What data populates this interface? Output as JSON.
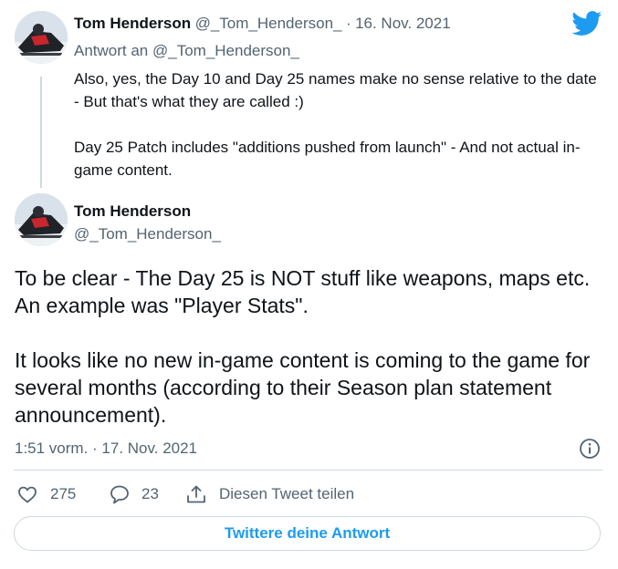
{
  "reply_tweet": {
    "author_name": "Tom Henderson",
    "author_handle": "@_Tom_Henderson_",
    "separator": "·",
    "date": "16. Nov. 2021",
    "replying_to": "Antwort an @_Tom_Henderson_",
    "paragraphs": [
      "Also, yes, the Day 10 and Day 25 names make no sense relative to the date - But that's what they are called :)",
      "Day 25 Patch includes \"additions pushed from launch\" - And not actual in-game content."
    ]
  },
  "main_tweet": {
    "author_name": "Tom Henderson",
    "author_handle": "@_Tom_Henderson_",
    "paragraphs": [
      "To be clear - The Day 25 is NOT stuff like weapons, maps etc. An example was \"Player Stats\".",
      "It looks like no new in-game content is coming to the game for several months (according to their Season plan statement announcement)."
    ],
    "timestamp": "1:51 vorm. · 17. Nov. 2021"
  },
  "actions": {
    "likes": "275",
    "replies": "23",
    "share_label": "Diesen Tweet teilen"
  },
  "reply_button_label": "Twittere deine Antwort",
  "colors": {
    "twitter_blue": "#1d9bf0",
    "secondary_text": "#536471",
    "border": "#cfd9de"
  },
  "icons": [
    "twitter-bird-icon",
    "info-icon",
    "heart-icon",
    "comment-icon",
    "share-icon"
  ]
}
